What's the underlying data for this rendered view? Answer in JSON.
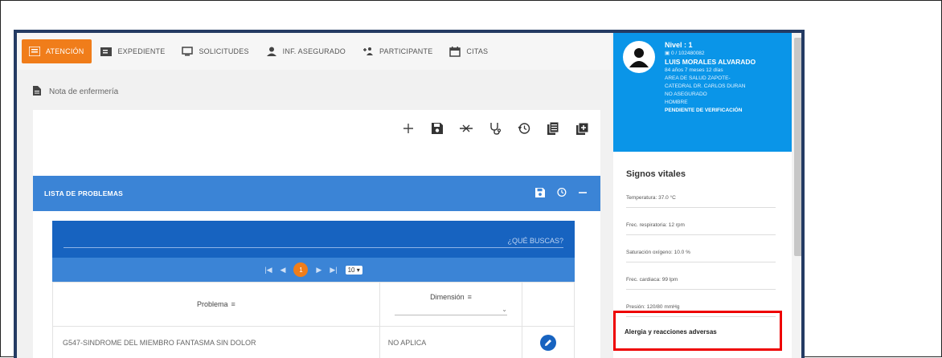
{
  "nav": {
    "tabs": [
      {
        "label": "ATENCIÓN",
        "icon": "attention-icon"
      },
      {
        "label": "EXPEDIENTE",
        "icon": "folder-icon"
      },
      {
        "label": "SOLICITUDES",
        "icon": "monitor-icon"
      },
      {
        "label": "INF. ASEGURADO",
        "icon": "person-icon"
      },
      {
        "label": "PARTICIPANTE",
        "icon": "add-group-icon"
      },
      {
        "label": "CITAS",
        "icon": "calendar-icon"
      }
    ]
  },
  "breadcrumb": {
    "label": "Nota de enfermería"
  },
  "problems": {
    "title": "LISTA DE PROBLEMAS",
    "search_placeholder": "¿QUÉ BUSCAS?",
    "pager": {
      "current_page": "1",
      "page_size": "10"
    },
    "columns": {
      "problem": "Problema",
      "dimension": "Dimensión"
    },
    "rows": [
      {
        "problem": "G547-SINDROME DEL MIEMBRO FANTASMA SIN DOLOR",
        "dimension": "NO APLICA"
      }
    ]
  },
  "patient": {
    "level": "Nivel : 1",
    "id": "0 / 102480082",
    "name": "LUIS MORALES ALVARADO",
    "age": "84 años 7 meses 12 días",
    "area": "AREA DE SALUD ZAPOTE-",
    "area2": "CATEDRAL DR. CARLOS DURAN",
    "insured": "NO ASEGURADO",
    "sex": "HOMBRE",
    "status": "PENDIENTE DE VERIFICACIÓN"
  },
  "vitals": {
    "title": "Signos vitales",
    "items": [
      "Temperatura: 37.0 °C",
      "Frec. respiratoria: 12 rpm",
      "Saturación oxígeno: 10.0 %",
      "Frec. cardiaca: 99 lpm",
      "Presión: 120/80 mmHg"
    ]
  },
  "allergy": {
    "title": "Alergia y reacciones adversas"
  },
  "colors": {
    "accent": "#f07d1a",
    "primary": "#3b84d6",
    "dark_blue": "#1763c0",
    "patient_bg": "#0a95e8",
    "highlight": "#ee0000"
  }
}
